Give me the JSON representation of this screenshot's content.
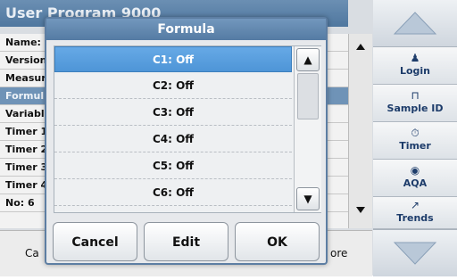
{
  "background": {
    "title": "User Program  9000",
    "rows": [
      {
        "label": "Name:"
      },
      {
        "label": "Version"
      },
      {
        "label": "Measur"
      },
      {
        "label": "Formul",
        "highlight": true
      },
      {
        "label": "Variabl"
      },
      {
        "label": "Timer 1"
      },
      {
        "label": "Timer 2"
      },
      {
        "label": "Timer 3"
      },
      {
        "label": "Timer 4"
      },
      {
        "label": "No: 6"
      }
    ],
    "bottom_left": "Ca",
    "bottom_right": "ore"
  },
  "side_panel": {
    "buttons": [
      {
        "label": "Login",
        "icon": "person-icon"
      },
      {
        "label": "Sample ID",
        "icon": "bottle-icon"
      },
      {
        "label": "Timer",
        "icon": "stopwatch-icon"
      },
      {
        "label": "AQA",
        "icon": "aqa-icon"
      },
      {
        "label": "Trends",
        "icon": "trend-chart-icon"
      }
    ]
  },
  "dialog": {
    "title": "Formula",
    "items": [
      {
        "label": "C1: Off",
        "selected": true
      },
      {
        "label": "C2: Off"
      },
      {
        "label": "C3: Off"
      },
      {
        "label": "C4: Off"
      },
      {
        "label": "C5: Off"
      },
      {
        "label": "C6: Off"
      }
    ],
    "buttons": {
      "cancel": "Cancel",
      "edit": "Edit",
      "ok": "OK"
    }
  }
}
